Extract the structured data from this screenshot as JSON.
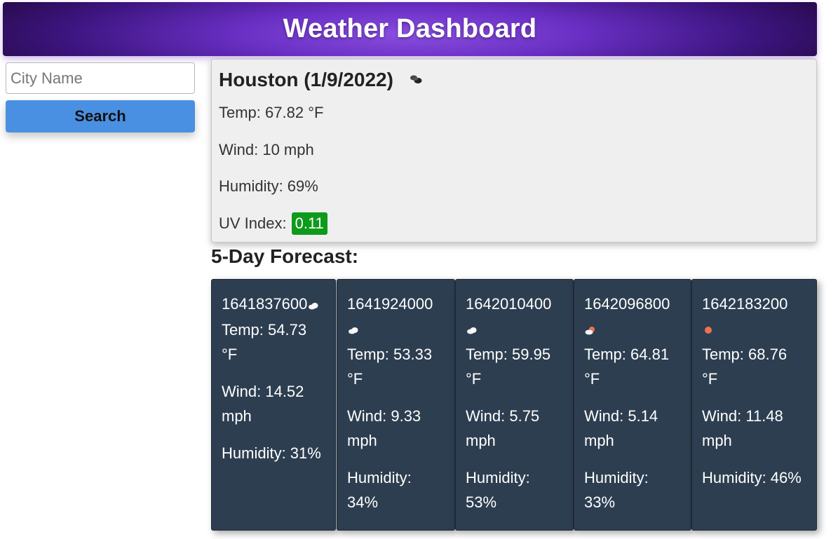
{
  "header": {
    "title": "Weather Dashboard"
  },
  "sidebar": {
    "search_placeholder": "City Name",
    "search_value": "",
    "search_button_label": "Search",
    "button_color": "#4a90e2"
  },
  "current": {
    "heading": "Houston (1/9/2022)",
    "icon": "broken-clouds-icon",
    "temp": "Temp: 67.82 °F",
    "wind": "Wind: 10 mph",
    "humidity": "Humidity: 69%",
    "uv_label": "UV Index:",
    "uv_value": "0.11",
    "uv_color": "#0e9a1b"
  },
  "forecast": {
    "title": "5-Day Forecast:",
    "card_color": "#2d3e50",
    "days": [
      {
        "date": "1641837600",
        "icon": "cloud-icon",
        "temp": "Temp: 54.73 °F",
        "wind": "Wind: 14.52 mph",
        "humidity": "Humidity: 31%"
      },
      {
        "date": "1641924000",
        "icon": "cloud-icon",
        "temp": "Temp: 53.33 °F",
        "wind": "Wind: 9.33 mph",
        "humidity": "Humidity: 34%"
      },
      {
        "date": "1642010400",
        "icon": "cloud-icon",
        "temp": "Temp: 59.95 °F",
        "wind": "Wind: 5.75 mph",
        "humidity": "Humidity: 53%"
      },
      {
        "date": "1642096800",
        "icon": "sun-cloud-icon",
        "temp": "Temp: 64.81 °F",
        "wind": "Wind: 5.14 mph",
        "humidity": "Humidity: 33%"
      },
      {
        "date": "1642183200",
        "icon": "sun-icon",
        "temp": "Temp: 68.76 °F",
        "wind": "Wind: 11.48 mph",
        "humidity": "Humidity: 46%"
      }
    ]
  }
}
